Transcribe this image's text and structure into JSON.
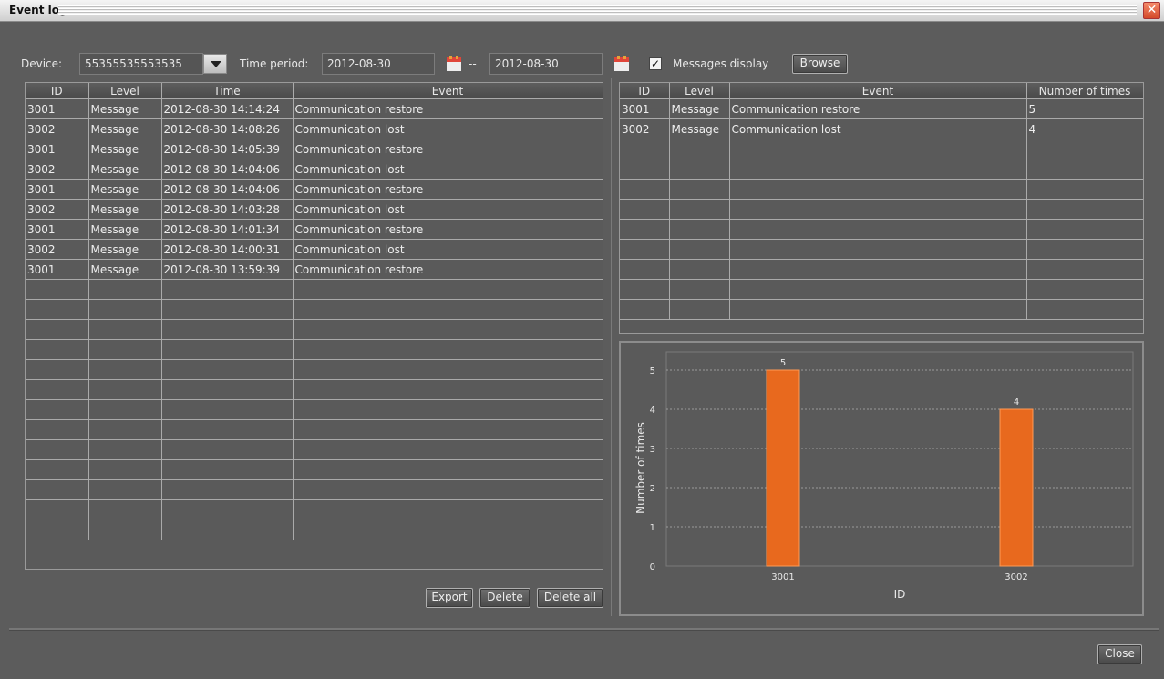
{
  "window": {
    "title": "Event log"
  },
  "filter": {
    "device_label": "Device:",
    "device_value": "55355535553535",
    "time_label": "Time period:",
    "date_from": "2012-08-30",
    "date_sep": "--",
    "date_to": "2012-08-30",
    "messages_display_label": "Messages display",
    "messages_display_checked": true,
    "browse_label": "Browse"
  },
  "event_table": {
    "columns": [
      "ID",
      "Level",
      "Time",
      "Event"
    ],
    "rows": [
      [
        "3001",
        "Message",
        "2012-08-30 14:14:24",
        "Communication restore"
      ],
      [
        "3002",
        "Message",
        "2012-08-30 14:08:26",
        "Communication lost"
      ],
      [
        "3001",
        "Message",
        "2012-08-30 14:05:39",
        "Communication restore"
      ],
      [
        "3002",
        "Message",
        "2012-08-30 14:04:06",
        "Communication lost"
      ],
      [
        "3001",
        "Message",
        "2012-08-30 14:04:06",
        "Communication restore"
      ],
      [
        "3002",
        "Message",
        "2012-08-30 14:03:28",
        "Communication lost"
      ],
      [
        "3001",
        "Message",
        "2012-08-30 14:01:34",
        "Communication restore"
      ],
      [
        "3002",
        "Message",
        "2012-08-30 14:00:31",
        "Communication lost"
      ],
      [
        "3001",
        "Message",
        "2012-08-30 13:59:39",
        "Communication restore"
      ]
    ]
  },
  "summary_table": {
    "columns": [
      "ID",
      "Level",
      "Event",
      "Number of times"
    ],
    "rows": [
      [
        "3001",
        "Message",
        "Communication restore",
        "5"
      ],
      [
        "3002",
        "Message",
        "Communication lost",
        "4"
      ]
    ]
  },
  "actions": {
    "export": "Export",
    "delete": "Delete",
    "delete_all": "Delete all",
    "close": "Close"
  },
  "chart_data": {
    "type": "bar",
    "categories": [
      "3001",
      "3002"
    ],
    "values": [
      5,
      4
    ],
    "data_labels": [
      "5",
      "4"
    ],
    "xlabel": "ID",
    "ylabel": "Number of times",
    "ylim": [
      0,
      5
    ],
    "yticks": [
      "0",
      "1",
      "2",
      "3",
      "4",
      "5"
    ],
    "grid": true,
    "bar_color": "#e8691e"
  },
  "colors": {
    "accent_bar": "#e8691e",
    "window_bg": "#5c5c5c"
  }
}
